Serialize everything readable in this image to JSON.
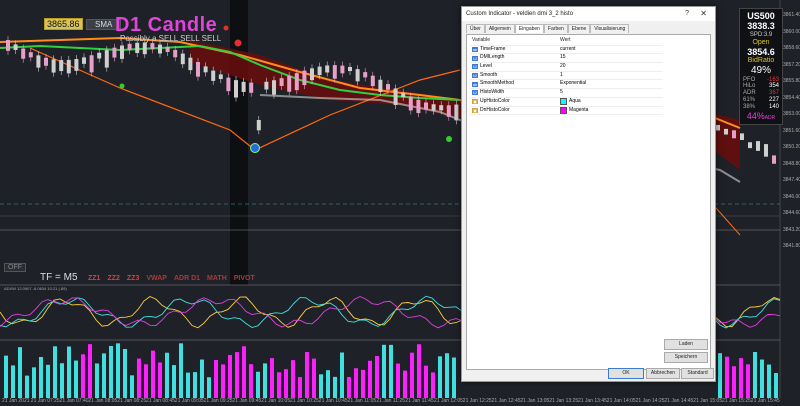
{
  "chart": {
    "symbol_price_tag": "3865.86",
    "sma_button": "SMA",
    "title": "D1 Candle",
    "subtitle": "Possibly a SELL SELL SELL",
    "off_button": "OFF",
    "tf_label": "TF = M5",
    "tools": [
      "ZZ1",
      "ZZ2",
      "ZZ3",
      "VWAP",
      "ADR D1",
      "MATH",
      "PIVOT"
    ],
    "indicator1_label": "ADXW 12.0907 -6.0634 10.21 (.89)",
    "y_labels": [
      "3861.40",
      "3860.00",
      "3858.60",
      "3857.20",
      "3855.80",
      "3854.40",
      "3853.00",
      "3851.60",
      "3850.20",
      "3848.80",
      "3847.40",
      "3846.00",
      "3844.60",
      "3843.20",
      "3841.80"
    ],
    "x_labels": [
      "21 Jan 2021",
      "21 Jan 07:25",
      "21 Jan 07:40",
      "21 Jan 08:05",
      "21 Jan 08:25",
      "21 Jan 08:45",
      "21 Jan 09:05",
      "21 Jan 09:25",
      "21 Jan 09:45",
      "21 Jan 10:05",
      "21 Jan 10:25",
      "21 Jan 10:45",
      "21 Jan 11:05",
      "21 Jan 11:25",
      "21 Jan 11:45",
      "21 Jan 12:05",
      "21 Jan 12:25",
      "21 Jan 12:45",
      "21 Jan 13:05",
      "21 Jan 13:25",
      "21 Jan 13:45",
      "21 Jan 14:05",
      "21 Jan 14:25",
      "21 Jan 14:45",
      "21 Jan 15:05",
      "21 Jan 15:25",
      "21 Jan 15:45"
    ],
    "colors": {
      "bull": "#e6a0c8",
      "bear": "#cfcfcf",
      "magenta": "#ff20ff",
      "aqua": "#40e0e0",
      "orange": "#ff7a1a",
      "green": "#30d040",
      "red_band": "#7a1010"
    }
  },
  "info_panel": {
    "symbol": "US500",
    "price": "3838.3",
    "spread": "SPD:3.9",
    "open_label": "Open",
    "open_value": "3854.6",
    "bid_ratio_label": "BidRatio",
    "bid_ratio_value": "49%",
    "rows": [
      {
        "k": "PFO",
        "v": "-163"
      },
      {
        "k": "HiLo",
        "v": "354"
      },
      {
        "k": "ADR",
        "v": "367"
      },
      {
        "k": "61%",
        "v": "227"
      },
      {
        "k": "38%",
        "v": "140"
      }
    ],
    "adr_pct": "44%",
    "adr_suffix": "ADR"
  },
  "dialog": {
    "title": "Custom Indicator - veldien dmi 3_2 histo",
    "help": "?",
    "close": "✕",
    "tabs": [
      "Über",
      "Allgemein",
      "Eingaben",
      "Farben",
      "Ebene",
      "Visualisierung"
    ],
    "active_tab": "Eingaben",
    "col_variable": "Variable",
    "col_value": "Wert",
    "rows": [
      {
        "type": "ab",
        "name": "TimeFrame",
        "value": "current"
      },
      {
        "type": "123",
        "name": "DMILength",
        "value": "15"
      },
      {
        "type": "123",
        "name": "Level",
        "value": "20"
      },
      {
        "type": "123",
        "name": "Smooth",
        "value": "1"
      },
      {
        "type": "ab",
        "name": "SmoothMethod",
        "value": "Exponential"
      },
      {
        "type": "123",
        "name": "HistoWidth",
        "value": "5"
      },
      {
        "type": "img",
        "name": "UpHistoColor",
        "value": "Aqua",
        "color": "#00ffff"
      },
      {
        "type": "img",
        "name": "DnHistoColor",
        "value": "Magenta",
        "color": "#ff00ff"
      }
    ],
    "btn_load": "Laden",
    "btn_save": "Speichern",
    "btn_ok": "OK",
    "btn_cancel": "Abbrechen",
    "btn_default": "Standard"
  }
}
